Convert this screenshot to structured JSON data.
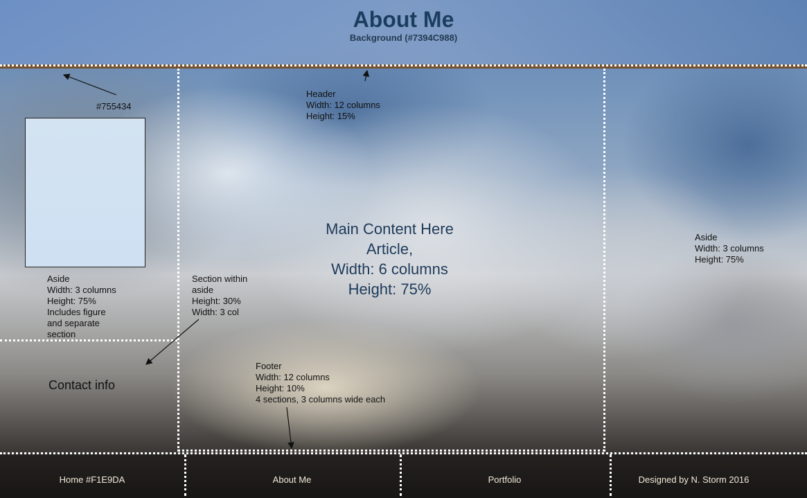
{
  "header": {
    "title": "About Me",
    "subtitle": "Background (#7394C988)",
    "border_color": "#755434"
  },
  "annotations": {
    "border_color_label": "#755434",
    "header_note": [
      "Header",
      "Width: 12 columns",
      "Height: 15%"
    ],
    "left_aside_note": [
      "Aside",
      "Width: 3 columns",
      "Height: 75%",
      "Includes figure",
      "and separate",
      "section"
    ],
    "section_note": [
      "Section within",
      "aside",
      "Height: 30%",
      "Width: 3 col"
    ],
    "right_aside_note": [
      "Aside",
      "Width: 3 columns",
      "Height: 75%"
    ],
    "footer_note": [
      "Footer",
      "Width: 12 columns",
      "Height: 10%",
      "4 sections, 3 columns wide each"
    ]
  },
  "aside_left": {
    "figure_color": "#CFE0F3",
    "contact": "Contact info"
  },
  "main": {
    "lines": [
      "Main Content Here",
      "Article,",
      "Width: 6 columns",
      "Height: 75%"
    ]
  },
  "footer": {
    "items": [
      "Home #F1E9DA",
      "About Me",
      "Portfolio",
      "Designed by N. Storm 2016"
    ],
    "text_color": "#F1E9DA"
  }
}
